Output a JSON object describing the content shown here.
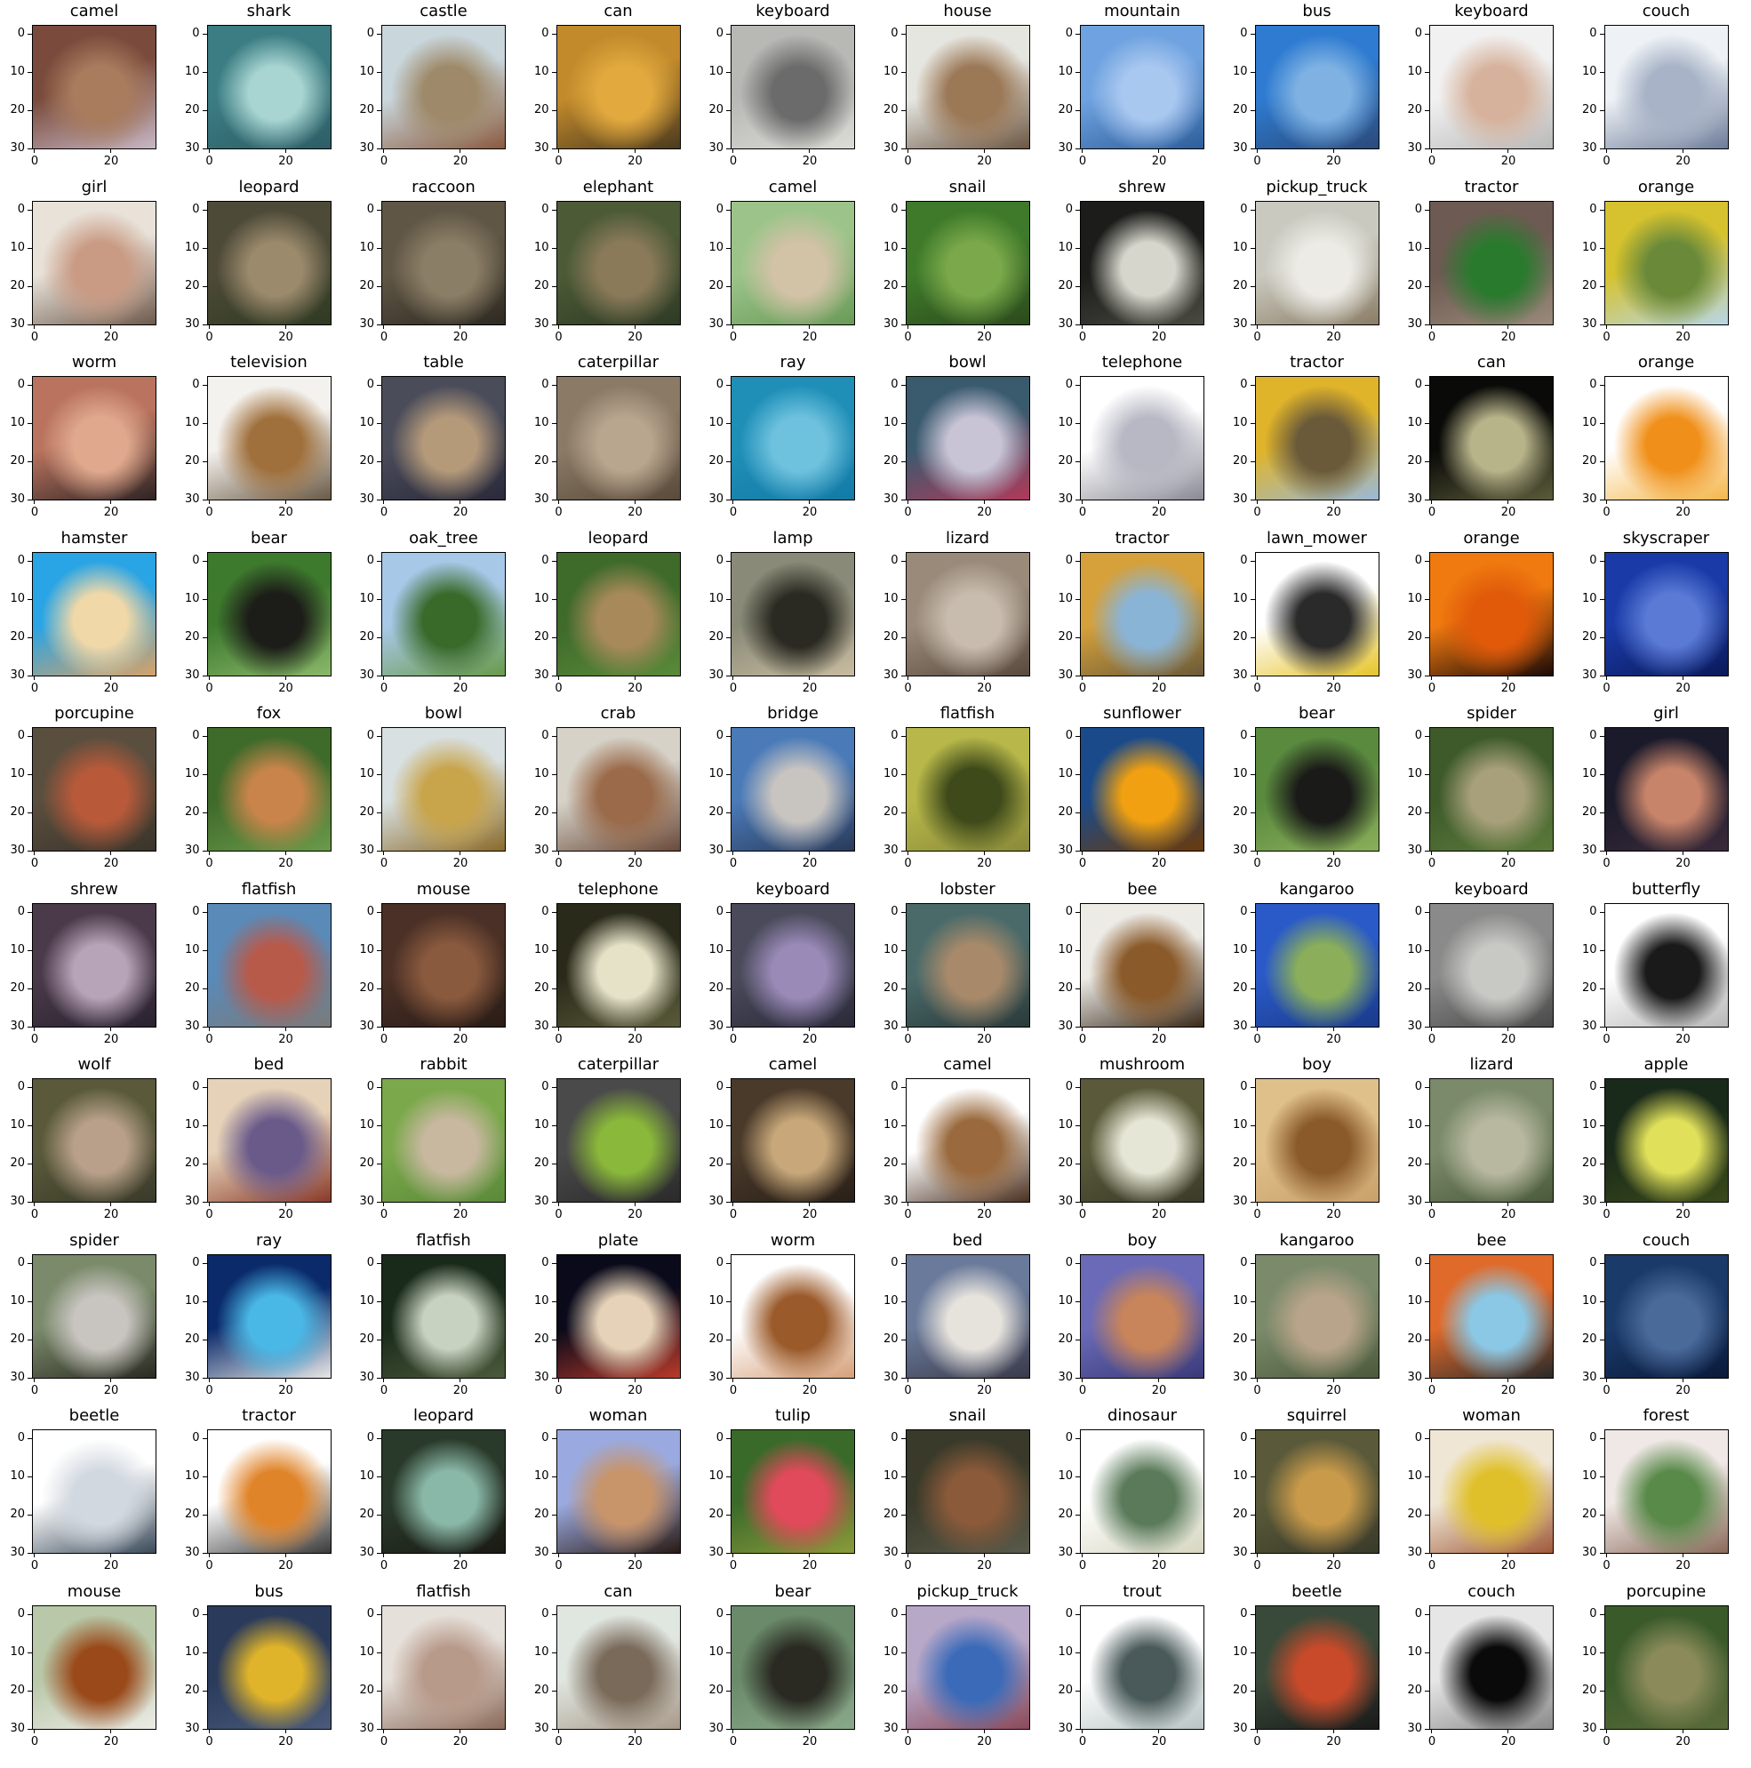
{
  "figure": {
    "rows": 10,
    "cols": 10,
    "x_ticks": [
      "0",
      "20"
    ],
    "y_ticks": [
      "0",
      "10",
      "20",
      "30"
    ]
  },
  "images": [
    {
      "label": "camel",
      "colors": [
        "#7a4b3c",
        "#a97c5e",
        "#c7b7c5"
      ]
    },
    {
      "label": "shark",
      "colors": [
        "#3b7d83",
        "#a8d5d2",
        "#2d5e66"
      ]
    },
    {
      "label": "castle",
      "colors": [
        "#c9d6dc",
        "#9e8a6a",
        "#8b5a3f"
      ]
    },
    {
      "label": "can",
      "colors": [
        "#c28a2b",
        "#e1a93e",
        "#4c3b1f"
      ]
    },
    {
      "label": "keyboard",
      "colors": [
        "#b8b8b5",
        "#6b6b6b",
        "#dcdcd6"
      ]
    },
    {
      "label": "house",
      "colors": [
        "#e6e6e0",
        "#9b7856",
        "#6b5643"
      ]
    },
    {
      "label": "mountain",
      "colors": [
        "#6fa2e0",
        "#a9c8f0",
        "#2d5e9c"
      ]
    },
    {
      "label": "bus",
      "colors": [
        "#2e7bd1",
        "#7fb2e3",
        "#2b4a7a"
      ]
    },
    {
      "label": "keyboard",
      "colors": [
        "#f1f1f1",
        "#d6b29c",
        "#b9b9b9"
      ]
    },
    {
      "label": "couch",
      "colors": [
        "#eef2f6",
        "#a8b3c7",
        "#6d7c99"
      ]
    },
    {
      "label": "girl",
      "colors": [
        "#e8e2d9",
        "#c99b84",
        "#6e5a4c"
      ]
    },
    {
      "label": "leopard",
      "colors": [
        "#4d4a38",
        "#9b8a6c",
        "#2f3a22"
      ]
    },
    {
      "label": "raccoon",
      "colors": [
        "#5f5645",
        "#8b7e66",
        "#2e2a22"
      ]
    },
    {
      "label": "elephant",
      "colors": [
        "#4c5a36",
        "#8a7a5a",
        "#2f3a25"
      ]
    },
    {
      "label": "camel",
      "colors": [
        "#9cc48a",
        "#d2c2a6",
        "#6a9a58"
      ]
    },
    {
      "label": "snail",
      "colors": [
        "#3e7a2a",
        "#7aa84a",
        "#2c4a1c"
      ]
    },
    {
      "label": "shrew",
      "colors": [
        "#1c1c1a",
        "#d6d6cc",
        "#4a4a42"
      ]
    },
    {
      "label": "pickup_truck",
      "colors": [
        "#c9c9bf",
        "#ecebe6",
        "#8b7d66"
      ]
    },
    {
      "label": "tractor",
      "colors": [
        "#6d5a52",
        "#2a7a2e",
        "#9a8a7a"
      ]
    },
    {
      "label": "orange",
      "colors": [
        "#d6c22e",
        "#6a8a3a",
        "#b8d6e6"
      ]
    },
    {
      "label": "worm",
      "colors": [
        "#b9735e",
        "#e0a98e",
        "#2e2424"
      ]
    },
    {
      "label": "television",
      "colors": [
        "#f4f2ee",
        "#a0703c",
        "#6a5a46"
      ]
    },
    {
      "label": "table",
      "colors": [
        "#4a4c5a",
        "#b59a7a",
        "#2a2a3a"
      ]
    },
    {
      "label": "caterpillar",
      "colors": [
        "#8a7a66",
        "#b8a68e",
        "#5a4a3a"
      ]
    },
    {
      "label": "ray",
      "colors": [
        "#1f8fb8",
        "#6fc2de",
        "#137aa6"
      ]
    },
    {
      "label": "bowl",
      "colors": [
        "#3a5a6e",
        "#c8c4d6",
        "#b03a5a"
      ]
    },
    {
      "label": "telephone",
      "colors": [
        "#ffffff",
        "#b8b8c4",
        "#8a8a96"
      ]
    },
    {
      "label": "tractor",
      "colors": [
        "#e0b42a",
        "#6a5a3a",
        "#9ab8d6"
      ]
    },
    {
      "label": "can",
      "colors": [
        "#0a0a08",
        "#b8b48a",
        "#5a5a3a"
      ]
    },
    {
      "label": "orange",
      "colors": [
        "#ffffff",
        "#f0901a",
        "#f5b64a"
      ]
    },
    {
      "label": "hamster",
      "colors": [
        "#29a4e4",
        "#f0d8a8",
        "#d6a268"
      ]
    },
    {
      "label": "bear",
      "colors": [
        "#3e7a2e",
        "#1c1c18",
        "#8ab86a"
      ]
    },
    {
      "label": "oak_tree",
      "colors": [
        "#a8c8e8",
        "#3a6a2a",
        "#6a9a4a"
      ]
    },
    {
      "label": "leopard",
      "colors": [
        "#3e6a2a",
        "#a88a5a",
        "#5a8a3a"
      ]
    },
    {
      "label": "lamp",
      "colors": [
        "#8a8a78",
        "#2a2a22",
        "#c8bca0"
      ]
    },
    {
      "label": "lizard",
      "colors": [
        "#9a8a7a",
        "#c8bcae",
        "#5a4a3e"
      ]
    },
    {
      "label": "tractor",
      "colors": [
        "#d6a03a",
        "#8ab4d6",
        "#6a5a3a"
      ]
    },
    {
      "label": "lawn_mower",
      "colors": [
        "#ffffff",
        "#2a2a2a",
        "#e6c42a"
      ]
    },
    {
      "label": "orange",
      "colors": [
        "#f07a10",
        "#e05a0a",
        "#1a0a06"
      ]
    },
    {
      "label": "skyscraper",
      "colors": [
        "#1a3aa8",
        "#5a7ad6",
        "#0a1a5a"
      ]
    },
    {
      "label": "porcupine",
      "colors": [
        "#5a4e3e",
        "#b85a3a",
        "#3a342a"
      ]
    },
    {
      "label": "fox",
      "colors": [
        "#3e6a2a",
        "#c8844a",
        "#6a9a4a"
      ]
    },
    {
      "label": "bowl",
      "colors": [
        "#d8e0e2",
        "#c8a44a",
        "#8a6a2a"
      ]
    },
    {
      "label": "crab",
      "colors": [
        "#d6d2c8",
        "#9a6a4a",
        "#6a4a3a"
      ]
    },
    {
      "label": "bridge",
      "colors": [
        "#4a7ab8",
        "#c8c4c0",
        "#2a3a5a"
      ]
    },
    {
      "label": "flatfish",
      "colors": [
        "#b8b84a",
        "#3e4a1a",
        "#8a8a3a"
      ]
    },
    {
      "label": "sunflower",
      "colors": [
        "#1a4a8a",
        "#f0a010",
        "#6a3a0a"
      ]
    },
    {
      "label": "bear",
      "colors": [
        "#5a8a3e",
        "#1a1a18",
        "#8aae5a"
      ]
    },
    {
      "label": "spider",
      "colors": [
        "#3e5a2a",
        "#a8a07a",
        "#5a7a3a"
      ]
    },
    {
      "label": "girl",
      "colors": [
        "#1a1a2a",
        "#c8846a",
        "#3a2a3a"
      ]
    },
    {
      "label": "shrew",
      "colors": [
        "#4a3a4a",
        "#b8a4b8",
        "#2a2230"
      ]
    },
    {
      "label": "flatfish",
      "colors": [
        "#5a8ab8",
        "#b85a4a",
        "#7a7a7a"
      ]
    },
    {
      "label": "mouse",
      "colors": [
        "#4a3026",
        "#8a5a3e",
        "#2a1c16"
      ]
    },
    {
      "label": "telephone",
      "colors": [
        "#2a2a1a",
        "#e6e2c8",
        "#5a5a3a"
      ]
    },
    {
      "label": "keyboard",
      "colors": [
        "#4a4a5a",
        "#9a8ab8",
        "#2a2a3a"
      ]
    },
    {
      "label": "lobster",
      "colors": [
        "#4a6a6a",
        "#a88a6a",
        "#2a3a3a"
      ]
    },
    {
      "label": "bee",
      "colors": [
        "#ecebe6",
        "#8a5a2a",
        "#3a2a1a"
      ]
    },
    {
      "label": "kangaroo",
      "colors": [
        "#2a5ac8",
        "#8aae5a",
        "#1a3a8a"
      ]
    },
    {
      "label": "keyboard",
      "colors": [
        "#8a8a8a",
        "#c8c8c4",
        "#4a4a4a"
      ]
    },
    {
      "label": "butterfly",
      "colors": [
        "#ffffff",
        "#1a1a1a",
        "#b8b8b8"
      ]
    },
    {
      "label": "wolf",
      "colors": [
        "#5a5a3a",
        "#b8a08a",
        "#3a3a2a"
      ]
    },
    {
      "label": "bed",
      "colors": [
        "#e6d2b8",
        "#6a5a8a",
        "#8a3a2a"
      ]
    },
    {
      "label": "rabbit",
      "colors": [
        "#7aa84a",
        "#c8b8a0",
        "#5a8a3a"
      ]
    },
    {
      "label": "caterpillar",
      "colors": [
        "#4a4a4a",
        "#8ab83a",
        "#2a2a2a"
      ]
    },
    {
      "label": "camel",
      "colors": [
        "#4a3a2a",
        "#c8a87a",
        "#2a2018"
      ]
    },
    {
      "label": "camel",
      "colors": [
        "#ffffff",
        "#9a6a3e",
        "#4a3020"
      ]
    },
    {
      "label": "mushroom",
      "colors": [
        "#5a5a3a",
        "#e6e6d6",
        "#3a3a2a"
      ]
    },
    {
      "label": "boy",
      "colors": [
        "#e0c08a",
        "#8a5a2a",
        "#c8a06a"
      ]
    },
    {
      "label": "lizard",
      "colors": [
        "#7a8a6a",
        "#b8b8a0",
        "#4a5a3a"
      ]
    },
    {
      "label": "apple",
      "colors": [
        "#1a2a1a",
        "#e0e05a",
        "#3a4a1a"
      ]
    },
    {
      "label": "spider",
      "colors": [
        "#7a8a6a",
        "#c8c4c0",
        "#2a2a22"
      ]
    },
    {
      "label": "ray",
      "colors": [
        "#0a2a6a",
        "#4ab8e6",
        "#e6e6e6"
      ]
    },
    {
      "label": "flatfish",
      "colors": [
        "#1a2a1a",
        "#c8d2c0",
        "#4a5a3a"
      ]
    },
    {
      "label": "plate",
      "colors": [
        "#0a0a1a",
        "#e6d2b8",
        "#b83a2a"
      ]
    },
    {
      "label": "worm",
      "colors": [
        "#ffffff",
        "#9a5a2a",
        "#d6a07a"
      ]
    },
    {
      "label": "bed",
      "colors": [
        "#6a7a9a",
        "#e6e2dc",
        "#3a3a4a"
      ]
    },
    {
      "label": "boy",
      "colors": [
        "#6a6ab8",
        "#c8845a",
        "#3a3a7a"
      ]
    },
    {
      "label": "kangaroo",
      "colors": [
        "#7a8a6a",
        "#b8a48a",
        "#4a5a3a"
      ]
    },
    {
      "label": "bee",
      "colors": [
        "#e06a2a",
        "#8ac8e6",
        "#2a2a2a"
      ]
    },
    {
      "label": "couch",
      "colors": [
        "#1a3a6a",
        "#4a6a9a",
        "#0a1a3a"
      ]
    },
    {
      "label": "beetle",
      "colors": [
        "#ffffff",
        "#d2d8e0",
        "#3a4a5a"
      ]
    },
    {
      "label": "tractor",
      "colors": [
        "#ffffff",
        "#e0842a",
        "#3a3a3a"
      ]
    },
    {
      "label": "leopard",
      "colors": [
        "#2a3a2a",
        "#8ab8a8",
        "#1a1a14"
      ]
    },
    {
      "label": "woman",
      "colors": [
        "#9aaae0",
        "#c8946a",
        "#2a1a14"
      ]
    },
    {
      "label": "tulip",
      "colors": [
        "#3a6a2a",
        "#e04a5a",
        "#8a9a3a"
      ]
    },
    {
      "label": "snail",
      "colors": [
        "#3a3a2a",
        "#8a5a3a",
        "#5a5a4a"
      ]
    },
    {
      "label": "dinosaur",
      "colors": [
        "#ffffff",
        "#5a7a5a",
        "#d6d6c0"
      ]
    },
    {
      "label": "squirrel",
      "colors": [
        "#5a5a3a",
        "#c89a4a",
        "#3a3a2a"
      ]
    },
    {
      "label": "woman",
      "colors": [
        "#f0e6d6",
        "#e0c02a",
        "#a05a3a"
      ]
    },
    {
      "label": "forest",
      "colors": [
        "#f0e8e6",
        "#5a8a4a",
        "#8a6a5a"
      ]
    },
    {
      "label": "mouse",
      "colors": [
        "#b8c8a8",
        "#9a4a1a",
        "#ecebe6"
      ]
    },
    {
      "label": "bus",
      "colors": [
        "#2a3a5a",
        "#e0b42a",
        "#4a5a7a"
      ]
    },
    {
      "label": "flatfish",
      "colors": [
        "#e6e0da",
        "#b89a8a",
        "#8a6a5a"
      ]
    },
    {
      "label": "can",
      "colors": [
        "#e0e6e0",
        "#7a6a5a",
        "#a89a8a"
      ]
    },
    {
      "label": "bear",
      "colors": [
        "#6a8a6a",
        "#2a2a22",
        "#8aa88a"
      ]
    },
    {
      "label": "pickup_truck",
      "colors": [
        "#b8a8c8",
        "#3a6ab8",
        "#8a4a5a"
      ]
    },
    {
      "label": "trout",
      "colors": [
        "#ffffff",
        "#4a5a5a",
        "#b8c4c4"
      ]
    },
    {
      "label": "beetle",
      "colors": [
        "#3a4a3a",
        "#c84a2a",
        "#1a1a1a"
      ]
    },
    {
      "label": "couch",
      "colors": [
        "#e6e6e6",
        "#0a0a0a",
        "#8a8a8a"
      ]
    },
    {
      "label": "porcupine",
      "colors": [
        "#3a5a2a",
        "#8a8a5a",
        "#5a6a3a"
      ]
    }
  ]
}
